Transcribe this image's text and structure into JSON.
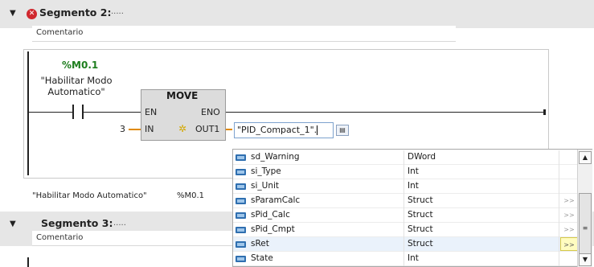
{
  "segment2": {
    "toggle": "▼",
    "title": "Segmento 2:",
    "dots": ".....",
    "comment": "Comentario",
    "error_icon": "error-x-icon"
  },
  "network": {
    "contact_address": "%M0.1",
    "contact_name_line1": "\"Habilitar Modo",
    "contact_name_line2": "Automatico\"",
    "block_name": "MOVE",
    "pin_en": "EN",
    "pin_eno": "ENO",
    "pin_in": "IN",
    "pin_out": "OUT1",
    "in_value": "3",
    "out_value": "\"PID_Compact_1\".",
    "out_marker": "✲"
  },
  "footer": {
    "tag_name": "\"Habilitar Modo Automatico\"",
    "tag_address": "%M0.1"
  },
  "segment3": {
    "toggle": "▼",
    "title": "Segmento 3:",
    "dots": ".....",
    "comment": "Comentario"
  },
  "popup": {
    "rows": [
      {
        "name": "sd_Warning",
        "type": "DWord",
        "more": ""
      },
      {
        "name": "si_Type",
        "type": "Int",
        "more": ""
      },
      {
        "name": "si_Unit",
        "type": "Int",
        "more": ""
      },
      {
        "name": "sParamCalc",
        "type": "Struct",
        "more": ">>"
      },
      {
        "name": "sPid_Calc",
        "type": "Struct",
        "more": ">>"
      },
      {
        "name": "sPid_Cmpt",
        "type": "Struct",
        "more": ">>"
      },
      {
        "name": "sRet",
        "type": "Struct",
        "more": ">>"
      },
      {
        "name": "State",
        "type": "Int",
        "more": ""
      }
    ],
    "selected_index": 6,
    "scroll_up": "▲",
    "scroll_down": "▼",
    "thumb_grip": "≡"
  }
}
